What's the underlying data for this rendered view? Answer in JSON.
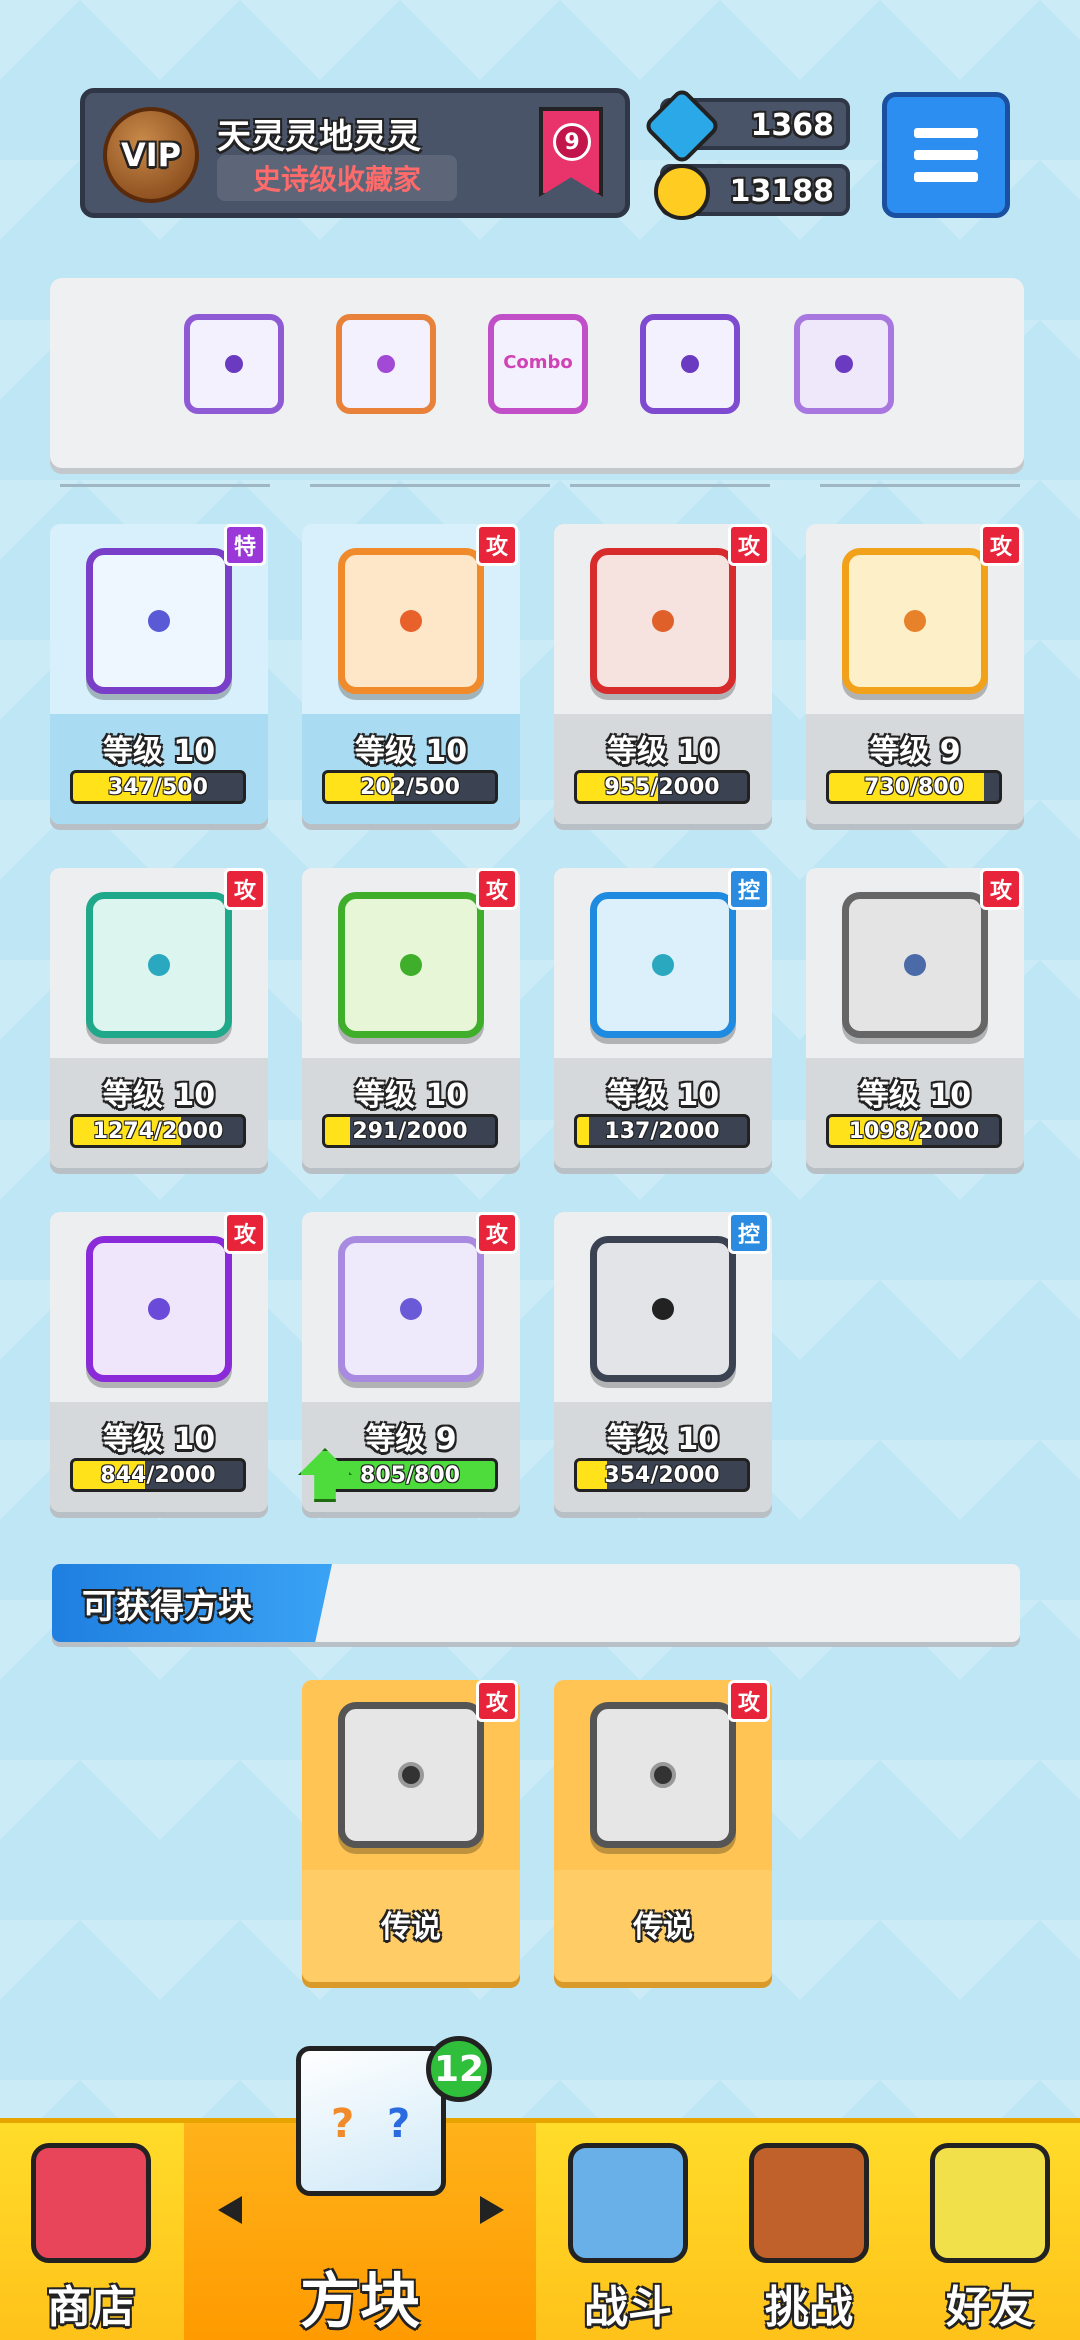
{
  "header": {
    "vip_label": "VIP",
    "player_name": "天灵灵地灵灵",
    "player_title": "史诗级收藏家",
    "rank_level": "9",
    "gems": "1368",
    "coins": "13188"
  },
  "deck": {
    "slots": [
      {
        "name": "slot-1",
        "text": ""
      },
      {
        "name": "slot-2",
        "text": ""
      },
      {
        "name": "slot-3",
        "text": "Combo"
      },
      {
        "name": "slot-4",
        "text": ""
      },
      {
        "name": "slot-5",
        "text": ""
      }
    ]
  },
  "cards": [
    {
      "tag": "特",
      "level": "等级 10",
      "progress": "347/500",
      "fraction": 0.694
    },
    {
      "tag": "攻",
      "level": "等级 10",
      "progress": "202/500",
      "fraction": 0.404
    },
    {
      "tag": "攻",
      "level": "等级 10",
      "progress": "955/2000",
      "fraction": 0.4775
    },
    {
      "tag": "攻",
      "level": "等级 9",
      "progress": "730/800",
      "fraction": 0.9125
    },
    {
      "tag": "攻",
      "level": "等级 10",
      "progress": "1274/2000",
      "fraction": 0.637
    },
    {
      "tag": "攻",
      "level": "等级 10",
      "progress": "291/2000",
      "fraction": 0.1455
    },
    {
      "tag": "控",
      "level": "等级 10",
      "progress": "137/2000",
      "fraction": 0.0685
    },
    {
      "tag": "攻",
      "level": "等级 10",
      "progress": "1098/2000",
      "fraction": 0.549
    },
    {
      "tag": "攻",
      "level": "等级 10",
      "progress": "844/2000",
      "fraction": 0.422
    },
    {
      "tag": "攻",
      "level": "等级 9",
      "progress": "805/800",
      "fraction": 1.0
    },
    {
      "tag": "控",
      "level": "等级 10",
      "progress": "354/2000",
      "fraction": 0.177
    }
  ],
  "obtainable": {
    "title": "可获得方块",
    "items": [
      {
        "tag": "攻",
        "rarity": "传说"
      },
      {
        "tag": "攻",
        "rarity": "传说"
      }
    ]
  },
  "nav": {
    "shop": "商店",
    "blocks": "方块",
    "battle": "战斗",
    "challenge": "挑战",
    "friends": "好友",
    "blocks_badge": "12"
  },
  "colors": {
    "attack_tag": "#e8243a",
    "special_tag": "#9b36d8",
    "control_tag": "#2b8be0",
    "progress_fill": "#ffe21a",
    "upgrade_fill": "#4ddc3c"
  }
}
